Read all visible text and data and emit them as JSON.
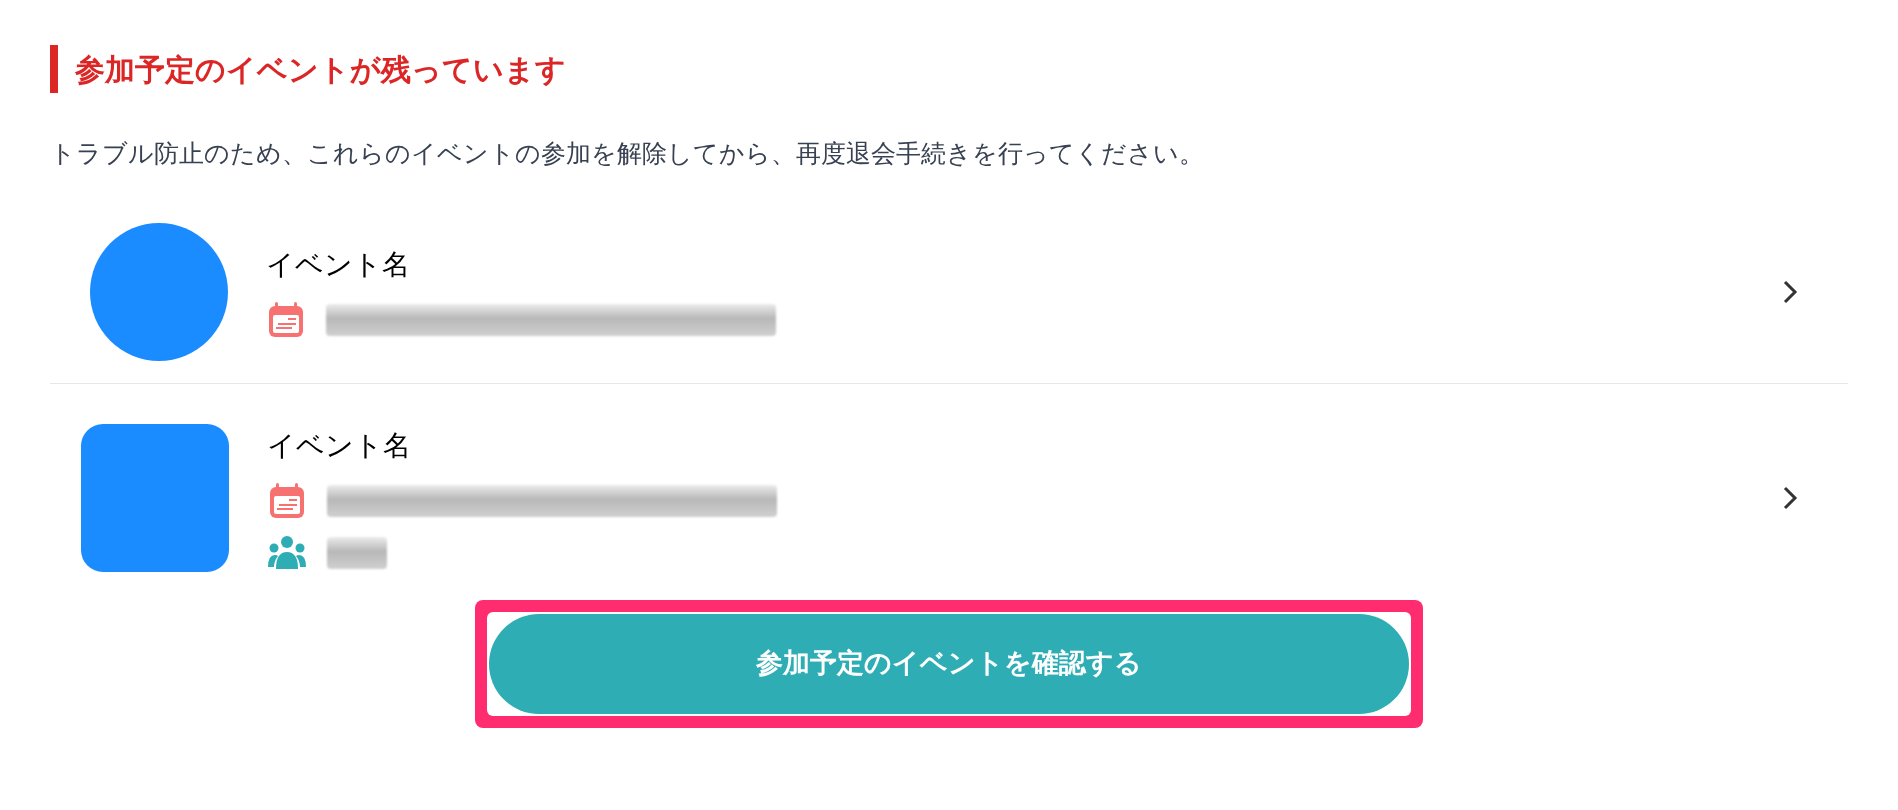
{
  "heading": "参加予定のイベントが残っています",
  "description": "トラブル防止のため、これらのイベントの参加を解除してから、再度退会手続きを行ってください。",
  "events": [
    {
      "name": "イベント名",
      "kind": "circle",
      "details": [
        {
          "kind": "date"
        }
      ]
    },
    {
      "name": "イベント名",
      "kind": "rounded",
      "details": [
        {
          "kind": "date"
        },
        {
          "kind": "members"
        }
      ]
    }
  ],
  "button": {
    "label": "参加予定のイベントを確認する",
    "highlighted": true
  }
}
